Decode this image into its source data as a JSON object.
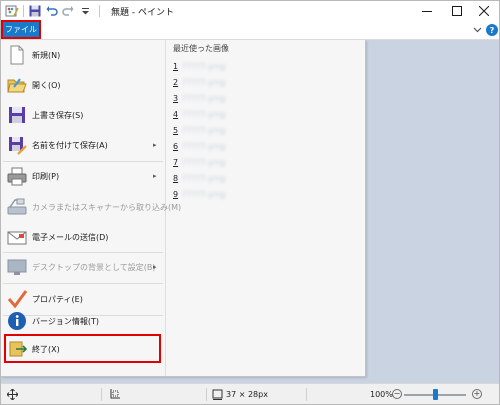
{
  "window": {
    "title": "無題 - ペイント",
    "minimize_glyph": "—",
    "maximize_glyph": "☐",
    "close_glyph": "✕"
  },
  "ribbon": {
    "file_tab_label": "ファイル",
    "help_label": "?"
  },
  "file_menu": {
    "items": [
      {
        "label": "新規(N)",
        "icon": "new-document-icon",
        "has_submenu": false,
        "enabled": true
      },
      {
        "label": "開く(O)",
        "icon": "open-folder-icon",
        "has_submenu": false,
        "enabled": true
      },
      {
        "label": "上書き保存(S)",
        "icon": "save-icon",
        "has_submenu": false,
        "enabled": true
      },
      {
        "label": "名前を付けて保存(A)",
        "icon": "save-as-icon",
        "has_submenu": true,
        "enabled": true
      },
      {
        "label": "印刷(P)",
        "icon": "printer-icon",
        "has_submenu": true,
        "enabled": true
      },
      {
        "label": "カメラまたはスキャナーから取り込み(M)",
        "icon": "scanner-icon",
        "has_submenu": false,
        "enabled": false
      },
      {
        "label": "電子メールの送信(D)",
        "icon": "email-icon",
        "has_submenu": false,
        "enabled": true
      },
      {
        "label": "デスクトップの背景として設定(B)",
        "icon": "desktop-background-icon",
        "has_submenu": true,
        "enabled": false
      },
      {
        "label": "プロパティ(E)",
        "icon": "checkmark-icon",
        "has_submenu": false,
        "enabled": true
      },
      {
        "label": "バージョン情報(T)",
        "icon": "info-icon",
        "has_submenu": false,
        "enabled": true
      },
      {
        "label": "終了(X)",
        "icon": "exit-icon",
        "has_submenu": false,
        "enabled": true
      }
    ],
    "submenu_arrow": "▸",
    "highlighted_item": "終了(X)"
  },
  "recent": {
    "title": "最近使った画像",
    "items": [
      {
        "num": "1",
        "name": "?????.png"
      },
      {
        "num": "2",
        "name": "?????.png"
      },
      {
        "num": "3",
        "name": "?????.png"
      },
      {
        "num": "4",
        "name": "?????.png"
      },
      {
        "num": "5",
        "name": "?????.png"
      },
      {
        "num": "6",
        "name": "?????.png"
      },
      {
        "num": "7",
        "name": "?????.png"
      },
      {
        "num": "8",
        "name": "?????.png"
      },
      {
        "num": "9",
        "name": "?????.png"
      }
    ]
  },
  "status": {
    "image_size": "37 × 28px",
    "zoom_level": "100%",
    "zoom_minus": "−",
    "zoom_plus": "+"
  },
  "colors": {
    "accent": "#1979ca",
    "highlight_border": "#e00000",
    "canvas_bg": "#c9d3e2"
  }
}
